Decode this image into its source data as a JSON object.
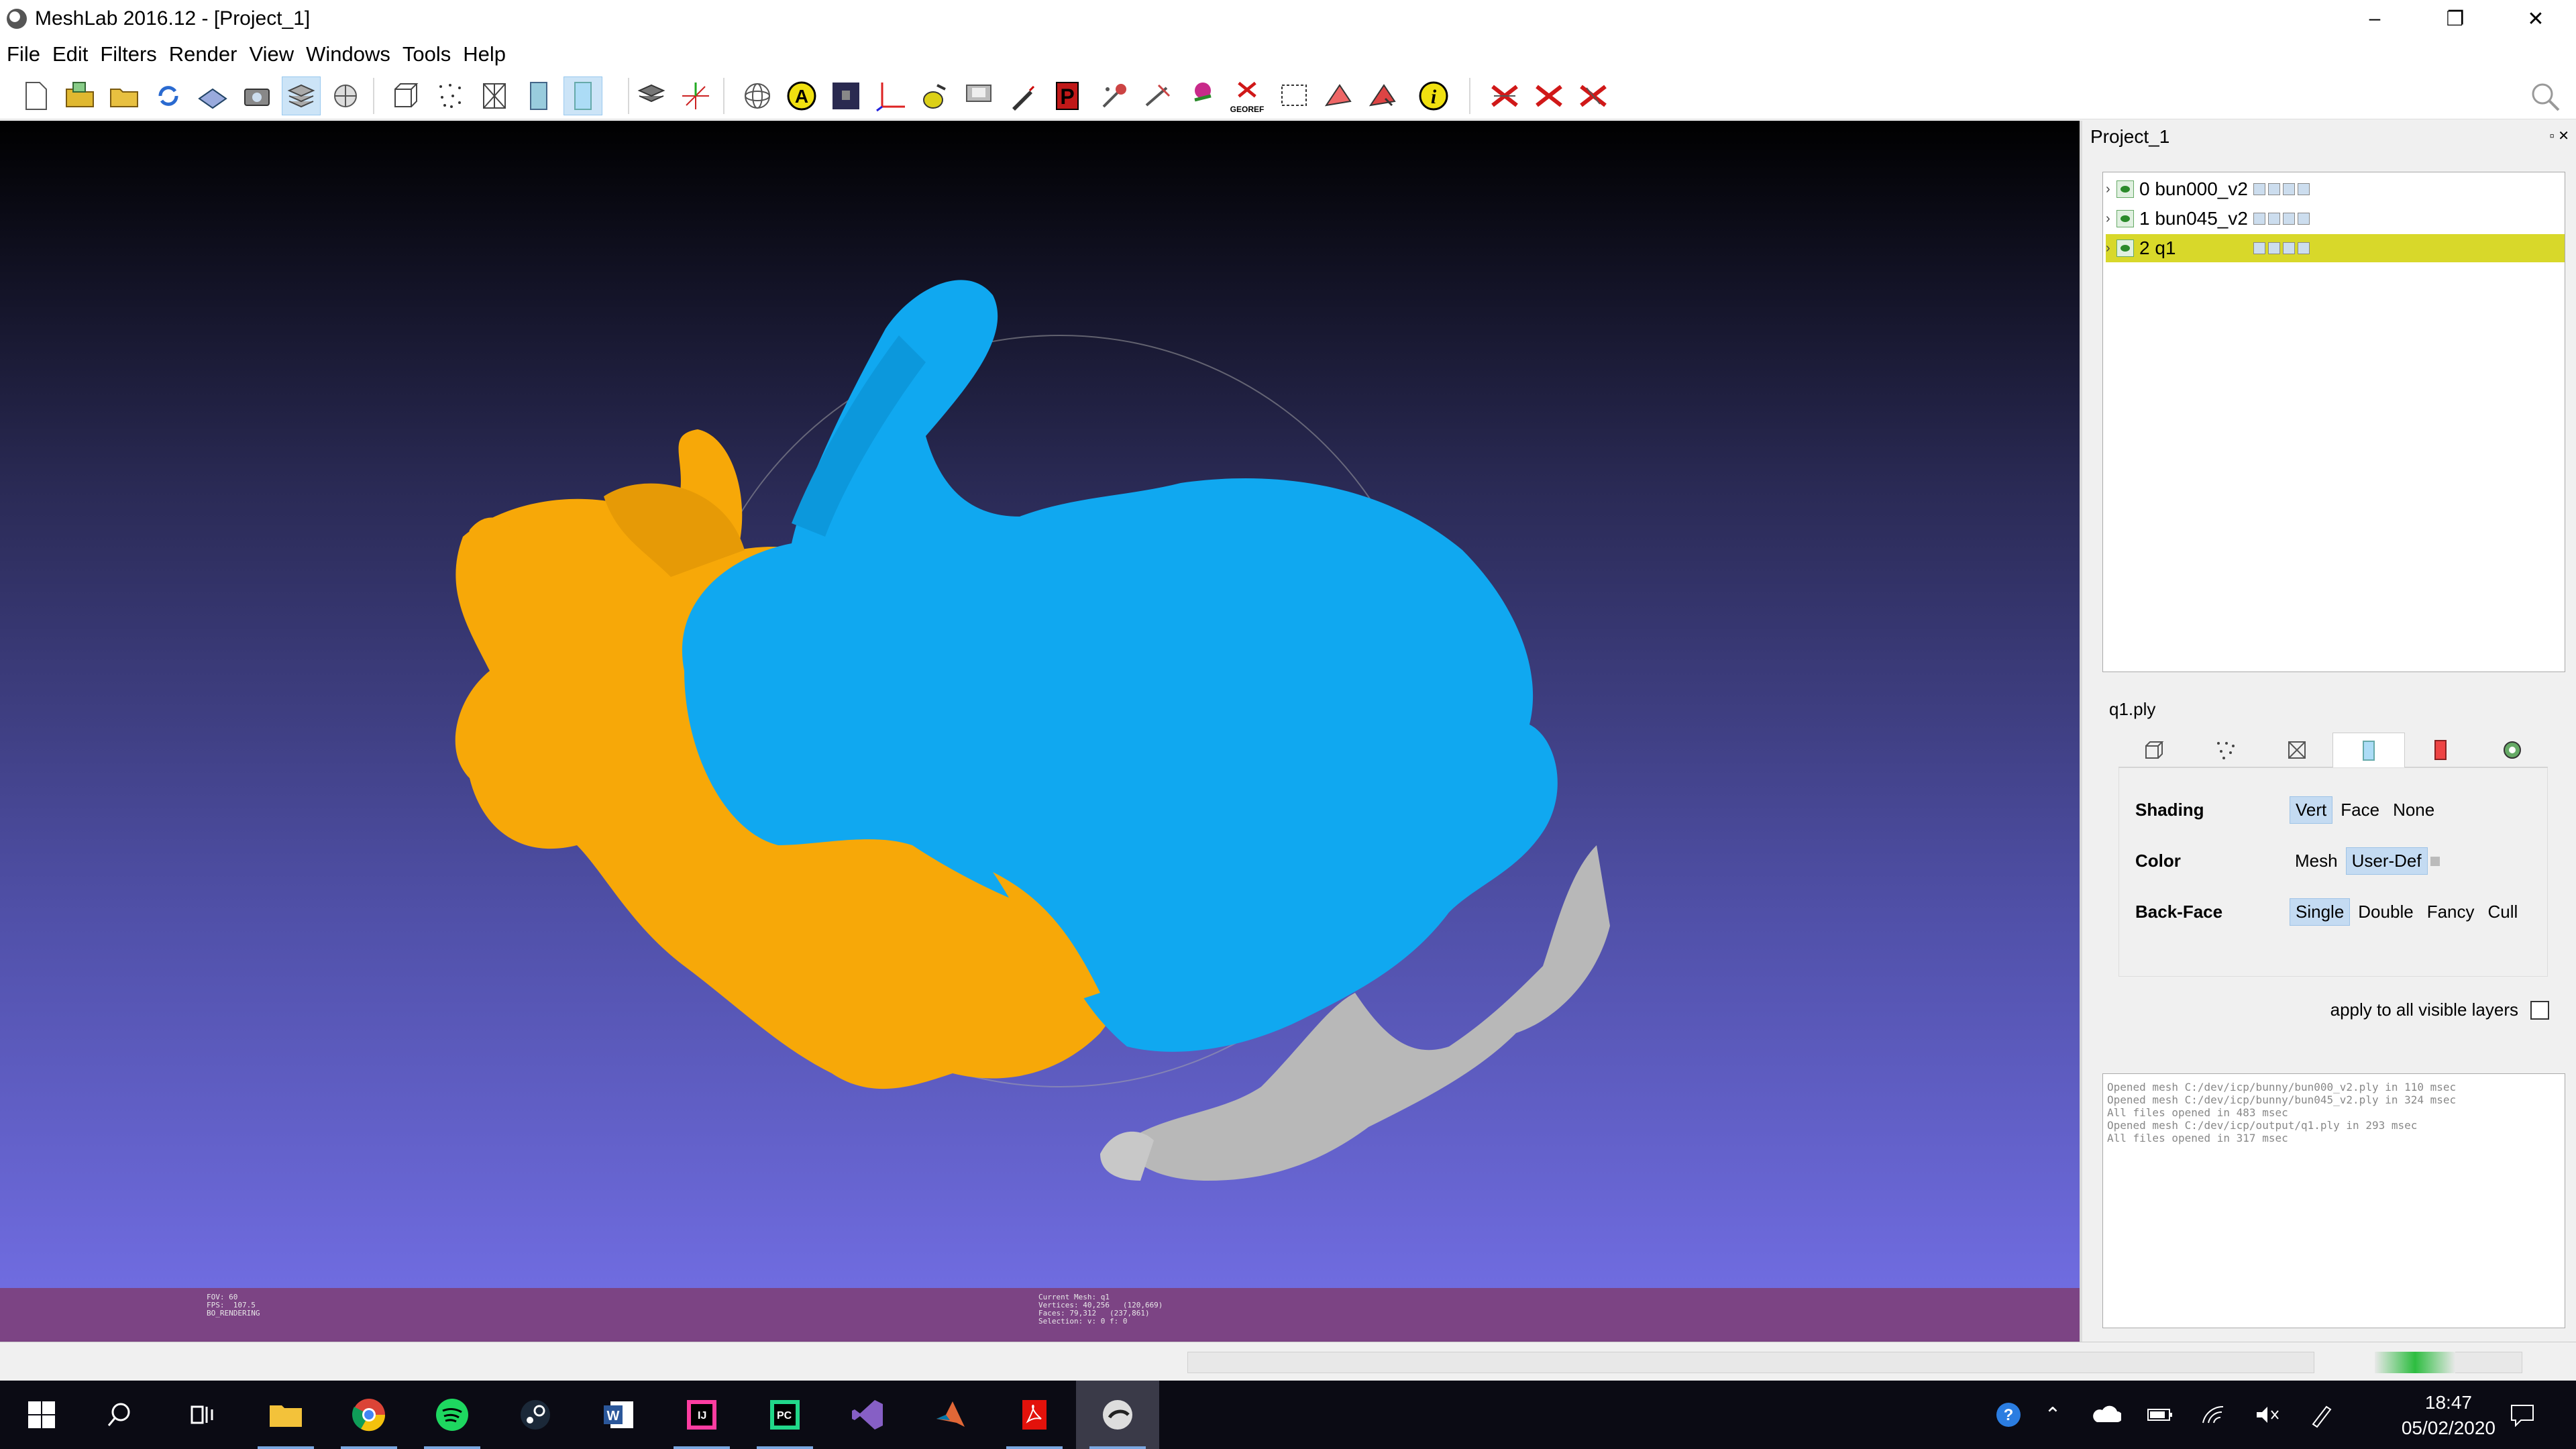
{
  "window": {
    "title": "MeshLab 2016.12 - [Project_1]",
    "minimize": "–",
    "restore": "❐",
    "close": "✕"
  },
  "menu": [
    {
      "key": "F",
      "rest": "ile"
    },
    {
      "key": "E",
      "rest": "dit"
    },
    {
      "key": "F",
      "rest": "ilters",
      "prefix": ""
    },
    {
      "key": "R",
      "rest": "ender"
    },
    {
      "key": "V",
      "rest": "iew"
    },
    {
      "key": "W",
      "rest": "indows"
    },
    {
      "key": "T",
      "rest": "ools"
    },
    {
      "key": "H",
      "rest": "elp"
    }
  ],
  "menu_labels": [
    "File",
    "Edit",
    "Filters",
    "Render",
    "View",
    "Windows",
    "Tools",
    "Help"
  ],
  "toolbar": {
    "icons": [
      "new-project-icon",
      "open-project-icon",
      "open-mesh-icon",
      "reload-icon",
      "save-icon",
      "snapshot-icon",
      "layers-icon",
      "globe-icon",
      "bbox-icon",
      "points-icon",
      "wireframe-icon",
      "flat-icon",
      "smooth-icon",
      "lighting-icon",
      "axis-icon",
      "trackball-icon",
      "annotation-icon",
      "raster-icon",
      "measure-icon",
      "color-paint-icon",
      "align-icon",
      "pick-points-icon",
      "paint-icon",
      "brush-icon",
      "select-faces-icon",
      "georef-icon",
      "select-region-icon",
      "select-vertices-icon",
      "manual-select-icon",
      "info-icon",
      "delete-faces-icon",
      "delete-vertices-icon",
      "delete-selection-icon"
    ],
    "georef_label": "GEOREF",
    "search_icon": "search-icon"
  },
  "viewport": {
    "info_left": "FOV: 60\nFPS:  107.5\nBO_RENDERING",
    "info_mid": "Current Mesh: q1\nVertices: 40,256   (120,669)\nFaces: 79,312   (237,861)\nSelection: v: 0 f: 0"
  },
  "panel": {
    "title": "Project_1",
    "layers": [
      {
        "label": "0 bun000_v2",
        "selected": false
      },
      {
        "label": "1 bun045_v2",
        "selected": false
      },
      {
        "label": "2 q1",
        "selected": true
      }
    ],
    "mesh_name": "q1.ply",
    "render_tabs": [
      "bbox-icon",
      "points-icon",
      "wireframe-icon",
      "solid-icon",
      "texture-icon",
      "settings-icon"
    ],
    "shading_label": "Shading",
    "shading_options": [
      "Vert",
      "Face",
      "None"
    ],
    "color_label": "Color",
    "color_options": [
      "Mesh",
      "User-Def"
    ],
    "backface_label": "Back-Face",
    "backface_options": [
      "Single",
      "Double",
      "Fancy",
      "Cull"
    ],
    "apply_all": "apply to all visible layers",
    "log": [
      "Opened mesh C:/dev/icp/bunny/bun000_v2.ply in 110 msec",
      "Opened mesh C:/dev/icp/bunny/bun045_v2.ply in 324 msec",
      "All files opened in 483 msec",
      "Opened mesh C:/dev/icp/output/q1.ply in 293 msec",
      "",
      "All files opened in 317 msec"
    ]
  },
  "taskbar": {
    "time": "18:47",
    "date": "05/02/2020",
    "apps": [
      "start",
      "search",
      "task-view",
      "file-explorer",
      "chrome",
      "spotify",
      "steam",
      "word",
      "intellij",
      "pycharm",
      "visual-studio",
      "matlab",
      "acrobat",
      "meshlab"
    ]
  },
  "colors": {
    "orange_mesh": "#f7a808",
    "blue_mesh": "#10a8f0",
    "grey_mesh": "#b8b8b8",
    "info_bar": "#7c4484",
    "selected_layer": "#d8d82a"
  }
}
